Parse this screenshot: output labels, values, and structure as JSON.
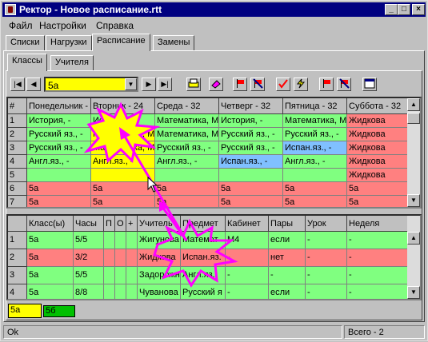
{
  "window": {
    "title": "Ректор - Новое расписание.rtt"
  },
  "title_buttons": {
    "minimize": "_",
    "maximize": "□",
    "close": "×"
  },
  "menu": [
    "Файл",
    "Настройки",
    "Справка"
  ],
  "main_tabs": [
    "Списки",
    "Нагрузки",
    "Расписание",
    "Замены"
  ],
  "sub_tabs": [
    "Классы",
    "Учителя"
  ],
  "toolbar": {
    "combo_value": "5а",
    "icons": [
      "first-icon",
      "prev-icon",
      "next-icon",
      "last-icon",
      "print-icon",
      "eraser-icon",
      "flag-red-icon",
      "flag-crossed-icon",
      "check-icon",
      "lightning-icon",
      "flag-red2-icon",
      "flag-crossed2-icon",
      "window-icon"
    ]
  },
  "schedule": {
    "headers": [
      "#",
      "Понедельник -",
      "Вторник - 24",
      "Среда - 32",
      "Четверг - 32",
      "Пятница - 32",
      "Суббота - 32"
    ],
    "rows": [
      {
        "num": "1",
        "cells": [
          "История, -",
          "История, -",
          "Математика, М",
          "История, -",
          "Математика, М",
          "Жидкова"
        ],
        "colors": [
          "g",
          "g",
          "g",
          "g",
          "g",
          "r"
        ]
      },
      {
        "num": "2",
        "cells": [
          "Русский яз., -",
          "Математика, М",
          "Математика, М",
          "Русский яз., -",
          "Русский яз., -",
          "Жидкова"
        ],
        "colors": [
          "g",
          "y",
          "g",
          "g",
          "g",
          "r"
        ]
      },
      {
        "num": "3",
        "cells": [
          "Русский яз., -",
          "Математика, М",
          "Русский яз., -",
          "Русский яз., -",
          "Испан.яз., -",
          "Жидкова"
        ],
        "colors": [
          "g",
          "y",
          "g",
          "g",
          "b",
          "r"
        ]
      },
      {
        "num": "4",
        "cells": [
          "Англ.яз., -",
          "Англ.яз., -",
          "Англ.яз., -",
          "Испан.яз., -",
          "Англ.яз., -",
          "Жидкова"
        ],
        "colors": [
          "g",
          "y",
          "g",
          "b",
          "g",
          "r"
        ]
      },
      {
        "num": "5",
        "cells": [
          "",
          "",
          "",
          "",
          "",
          "Жидкова"
        ],
        "colors": [
          "g",
          "y",
          "g",
          "g",
          "g",
          "r"
        ]
      },
      {
        "num": "6",
        "cells": [
          "5а",
          "5а",
          "5а",
          "5а",
          "5а",
          "5а"
        ],
        "colors": [
          "r",
          "r",
          "r",
          "r",
          "r",
          "r"
        ]
      },
      {
        "num": "7",
        "cells": [
          "5а",
          "5а",
          "5а",
          "5а",
          "5а",
          "5а"
        ],
        "colors": [
          "r",
          "r",
          "r",
          "r",
          "r",
          "r"
        ]
      }
    ]
  },
  "lessons": {
    "headers": [
      "",
      "Класс(ы)",
      "Часы",
      "П",
      "О",
      "+",
      "Учитель",
      "Предмет",
      "Кабинет",
      "Пары",
      "Урок",
      "Неделя"
    ],
    "rows": [
      {
        "cells": [
          "1",
          "5а",
          "5/5",
          "",
          "",
          "",
          "Жигунова",
          "Математ",
          "М4",
          "если",
          "-",
          "-"
        ],
        "color": "g"
      },
      {
        "cells": [
          "2",
          "5а",
          "3/2",
          "",
          "",
          "",
          "Жидкова",
          "Испан.яз.",
          "-",
          "нет",
          "-",
          "-"
        ],
        "color": "r"
      },
      {
        "cells": [
          "3",
          "5а",
          "5/5",
          "",
          "",
          "",
          "Задорожн",
          "Англ.яз.",
          "-",
          "-",
          "-",
          "-"
        ],
        "color": "g"
      },
      {
        "cells": [
          "4",
          "5а",
          "8/8",
          "",
          "",
          "",
          "Чуванова",
          "Русский я",
          "-",
          "если",
          "-",
          "-"
        ],
        "color": "g"
      }
    ]
  },
  "class_tabs": [
    "5а",
    "5б"
  ],
  "status": {
    "left": "Ok",
    "right": "Всего - 2"
  }
}
